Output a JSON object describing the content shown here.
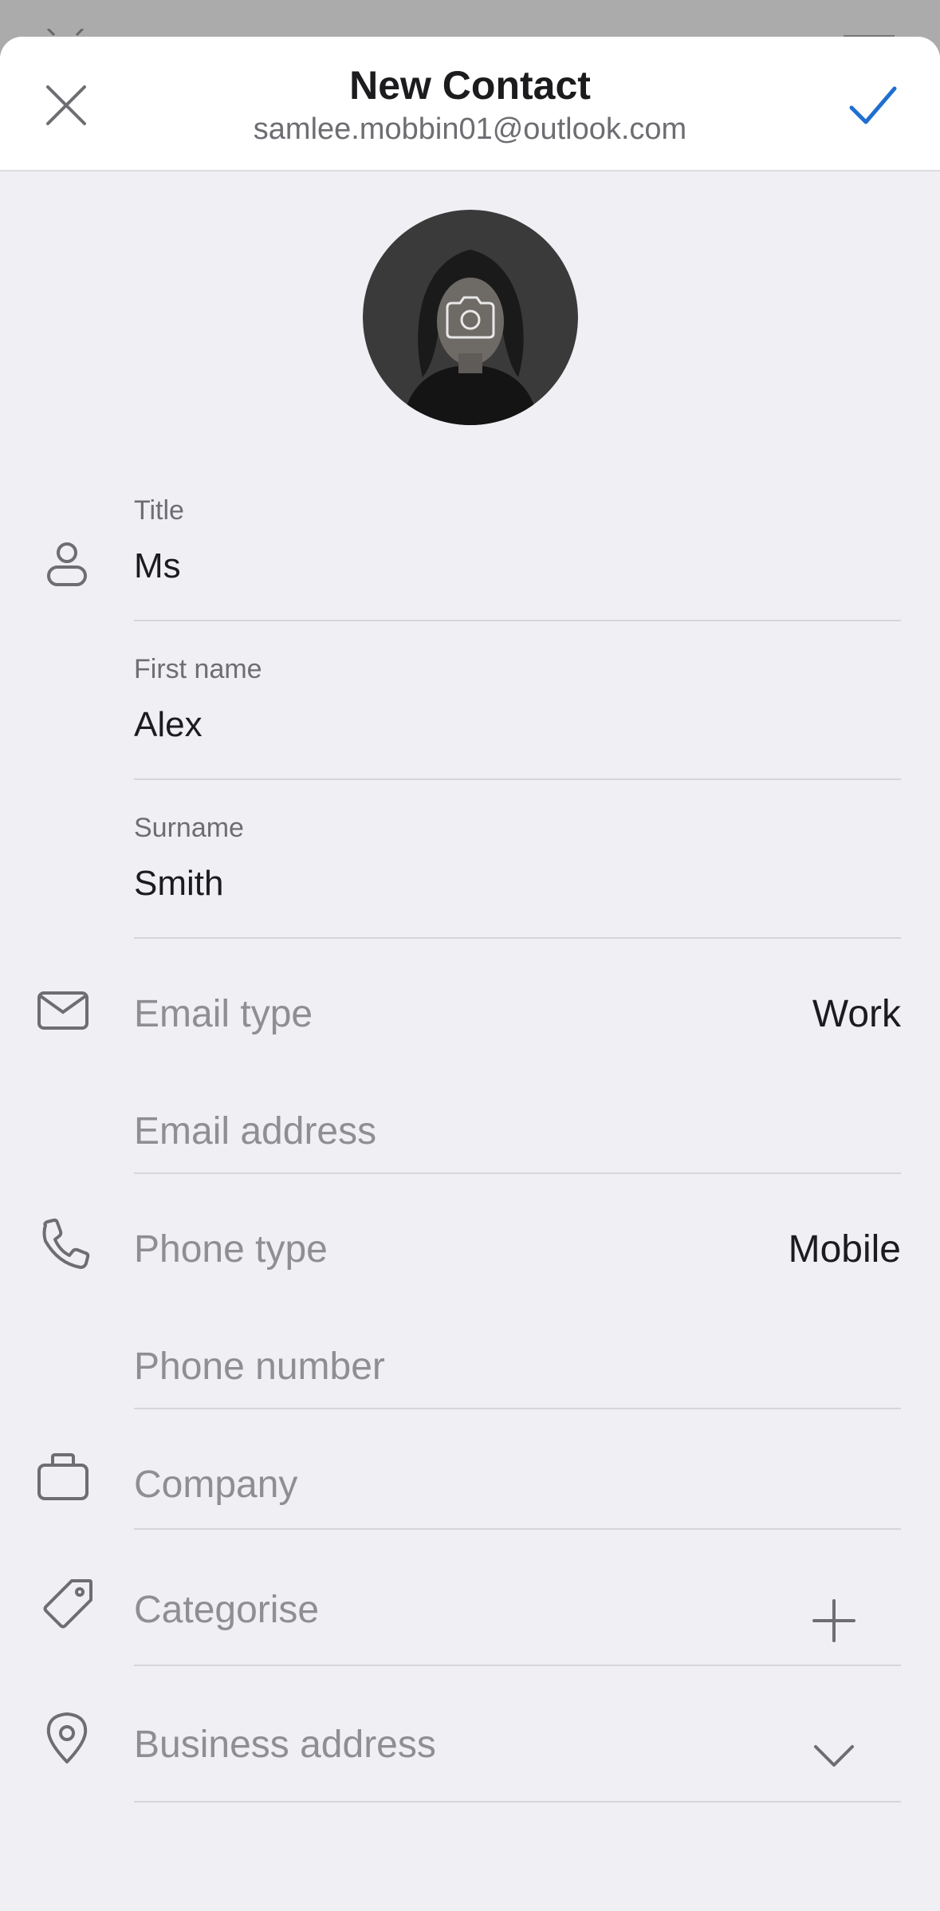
{
  "header": {
    "title": "New Contact",
    "account": "samlee.mobbin01@outlook.com",
    "close_icon": "close-icon",
    "save_icon": "checkmark-icon",
    "accent": "#1f6fd1"
  },
  "avatar": {
    "icon": "camera-icon",
    "description_icon": "contact-photo"
  },
  "fields": {
    "title": {
      "label": "Title",
      "value": "Ms"
    },
    "first_name": {
      "label": "First name",
      "value": "Alex"
    },
    "surname": {
      "label": "Surname",
      "value": "Smith"
    },
    "email_type": {
      "label": "Email type",
      "value": "Work"
    },
    "email_address": {
      "placeholder": "Email address"
    },
    "phone_type": {
      "label": "Phone type",
      "value": "Mobile"
    },
    "phone_number": {
      "placeholder": "Phone number"
    },
    "company": {
      "placeholder": "Company"
    },
    "categorise": {
      "placeholder": "Categorise"
    },
    "business_address": {
      "placeholder": "Business address"
    }
  },
  "icons": {
    "person": "person-icon",
    "mail": "envelope-icon",
    "phone": "phone-icon",
    "company": "briefcase-icon",
    "tag": "tag-icon",
    "location": "location-pin-icon",
    "add": "plus-icon",
    "expand": "chevron-down-icon"
  }
}
